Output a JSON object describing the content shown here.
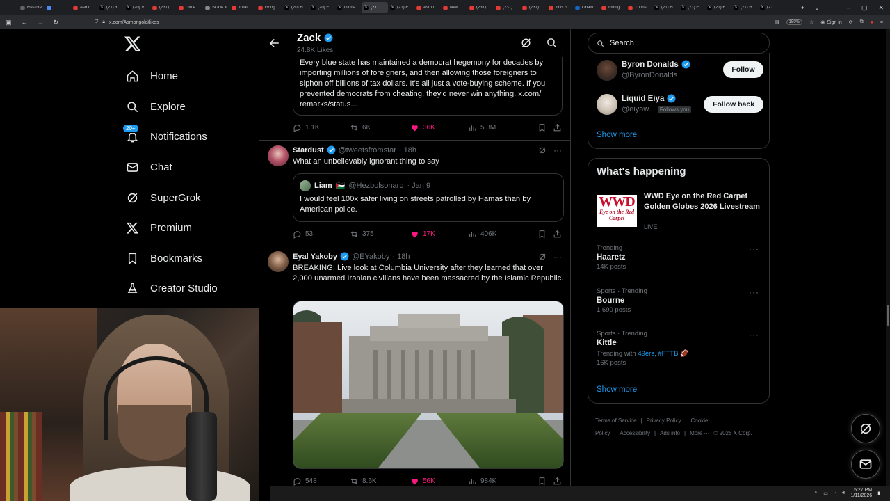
{
  "browser": {
    "tabs": [
      {
        "label": "Restore",
        "color": "#5f6368"
      },
      {
        "label": "",
        "color": "#4c8bf5"
      },
      {
        "label": "Asmo",
        "color": "#e53935"
      },
      {
        "label": "(21) Y",
        "color": "#ffffff"
      },
      {
        "label": "(20) V",
        "color": "#ffffff"
      },
      {
        "label": "(237)",
        "color": "#e53935"
      },
      {
        "label": "Did A",
        "color": "#e53935"
      },
      {
        "label": "SOUK Inm",
        "color": "#888888"
      },
      {
        "label": "Totall",
        "color": "#e53935"
      },
      {
        "label": "Goog",
        "color": "#e53935"
      },
      {
        "label": "(20) H",
        "color": "#ffffff"
      },
      {
        "label": "(20) F",
        "color": "#ffffff"
      },
      {
        "label": "Globa",
        "color": "#ffffff"
      },
      {
        "label": "(21",
        "color": "#ffffff",
        "active": true
      },
      {
        "label": "(21) E",
        "color": "#ffffff"
      },
      {
        "label": "Asmo",
        "color": "#e53935"
      },
      {
        "label": "New I",
        "color": "#e53935"
      },
      {
        "label": "(237)",
        "color": "#e53935"
      },
      {
        "label": "(237)",
        "color": "#e53935"
      },
      {
        "label": "(237)",
        "color": "#e53935"
      },
      {
        "label": "This is",
        "color": "#e53935"
      },
      {
        "label": "Obam",
        "color": "#1565c0"
      },
      {
        "label": "Immig",
        "color": "#e53935"
      },
      {
        "label": "Thous",
        "color": "#e53935"
      },
      {
        "label": "(21) H",
        "color": "#ffffff"
      },
      {
        "label": "(21) F",
        "color": "#ffffff"
      },
      {
        "label": "(21) F",
        "color": "#ffffff"
      },
      {
        "label": "(21) H",
        "color": "#ffffff"
      },
      {
        "label": "(21",
        "color": "#ffffff"
      }
    ],
    "url": "x.com/Asmongold/likes",
    "zoom": "150%",
    "signin": "Sign in"
  },
  "nav": {
    "items": [
      {
        "label": "Home",
        "icon": "home-icon"
      },
      {
        "label": "Explore",
        "icon": "search-icon"
      },
      {
        "label": "Notifications",
        "icon": "bell-icon",
        "badge": "20+"
      },
      {
        "label": "Chat",
        "icon": "mail-icon"
      },
      {
        "label": "SuperGrok",
        "icon": "grok-icon"
      },
      {
        "label": "Premium",
        "icon": "x-icon"
      },
      {
        "label": "Bookmarks",
        "icon": "bookmark-icon"
      },
      {
        "label": "Creator Studio",
        "icon": "flask-icon"
      }
    ]
  },
  "header": {
    "name": "Zack",
    "likes": "24.8K Likes"
  },
  "post1": {
    "quote_text": "Every blue state has maintained a democrat hegemony for decades by importing millions of foreigners, and then allowing those foreigners to siphon off billions of tax dollars. It's all just a vote-buying scheme. If you prevented democrats from cheating, they'd never win anything. x.com/ remarks/status...",
    "replies": "1.1K",
    "reposts": "6K",
    "likes": "36K",
    "views": "5.3M"
  },
  "post2": {
    "name": "Stardust",
    "handle": "@tweetsfromstar",
    "time": "· 18h",
    "text": "What an unbelievably ignorant thing to say",
    "quote": {
      "name": "Liam",
      "flag": "🇵🇸",
      "handle": "@Hezbolsonaro",
      "time": "· Jan 9",
      "text": "I would feel 100x safer living on streets patrolled by Hamas than by American police."
    },
    "replies": "53",
    "reposts": "375",
    "likes": "17K",
    "views": "406K"
  },
  "post3": {
    "name": "Eyal Yakoby",
    "handle": "@EYakoby",
    "time": "· 18h",
    "text": "BREAKING: Live look at Columbia University after they learned that over 2,000 unarmed Iranian civilians have been massacred by the Islamic Republic.",
    "replies": "548",
    "reposts": "8.6K",
    "likes": "56K",
    "views": "984K"
  },
  "search": {
    "placeholder": "Search"
  },
  "who_to_follow": {
    "items": [
      {
        "name": "Byron Donalds",
        "handle": "@ByronDonalds",
        "button": "Follow"
      },
      {
        "name": "Liquid Eiya",
        "handle": "@eiyaw...",
        "follows_you": "Follows you",
        "button": "Follow back"
      }
    ],
    "show_more": "Show more"
  },
  "whats_happening": {
    "title": "What's happening",
    "featured": {
      "title": "WWD Eye on the Red Carpet Golden Globes 2026 Livestream",
      "status": "LIVE",
      "logo_text": "WWD",
      "logo_sub": "Eye on the Red Carpet"
    },
    "trends": [
      {
        "context": "Trending",
        "title": "Haaretz",
        "count": "14K posts"
      },
      {
        "context": "Sports · Trending",
        "title": "Bourne",
        "count": "1,690 posts"
      },
      {
        "context": "Sports · Trending",
        "title": "Kittle",
        "extra_prefix": "Trending with ",
        "extra_tags": "49ers, #FTTB",
        "count": "16K posts"
      }
    ],
    "show_more": "Show more"
  },
  "footer": {
    "links": [
      "Terms of Service",
      "|",
      "Privacy Policy",
      "|",
      "Cookie Policy",
      "|",
      "Accessibility",
      "|",
      "Ads info",
      "|",
      "More ···",
      "© 2026 X Corp."
    ]
  },
  "taskbar": {
    "time": "5:27 PM",
    "date": "1/11/2026"
  },
  "colors": {
    "accent": "#1d9bf0",
    "like": "#f91880",
    "border": "#2f3336",
    "muted": "#71767b"
  }
}
